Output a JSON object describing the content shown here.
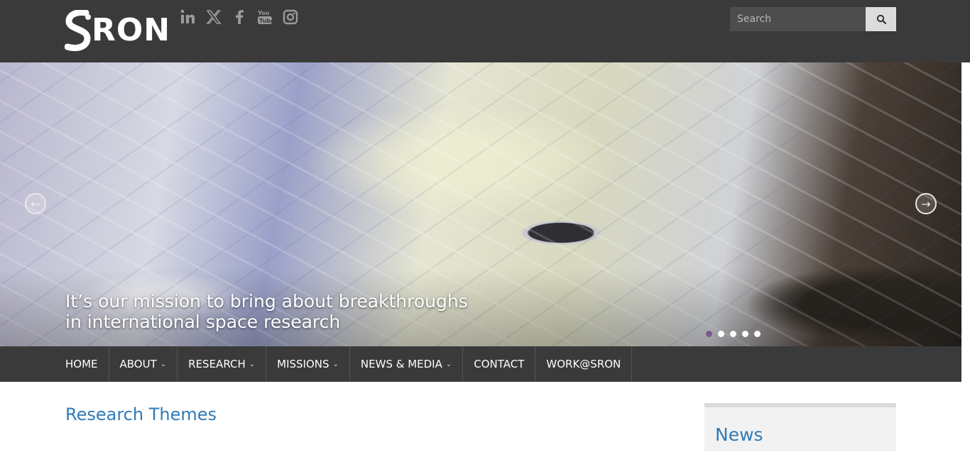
{
  "header": {
    "logo_text": "RON",
    "socials": [
      "linkedin-icon",
      "x-twitter-icon",
      "facebook-icon",
      "youtube-icon",
      "instagram-icon"
    ],
    "search": {
      "placeholder": "Search"
    }
  },
  "hero": {
    "caption_line1": "It’s our mission to bring about breakthroughs",
    "caption_line2": "in international space research",
    "slides": 5,
    "active_slide": 1
  },
  "nav": {
    "items": [
      {
        "label": "HOME",
        "dropdown": false
      },
      {
        "label": "ABOUT",
        "dropdown": true
      },
      {
        "label": "RESEARCH",
        "dropdown": true
      },
      {
        "label": "MISSIONS",
        "dropdown": true
      },
      {
        "label": "NEWS & MEDIA",
        "dropdown": true
      },
      {
        "label": "CONTACT",
        "dropdown": false
      },
      {
        "label": "WORK@SRON",
        "dropdown": false
      }
    ]
  },
  "main": {
    "title": "Research Themes"
  },
  "sidebar": {
    "news_title": "News"
  },
  "colors": {
    "topbar": "#3a3a3a",
    "link_blue": "#2e7bb8",
    "active_dot": "#7a5a8a"
  }
}
